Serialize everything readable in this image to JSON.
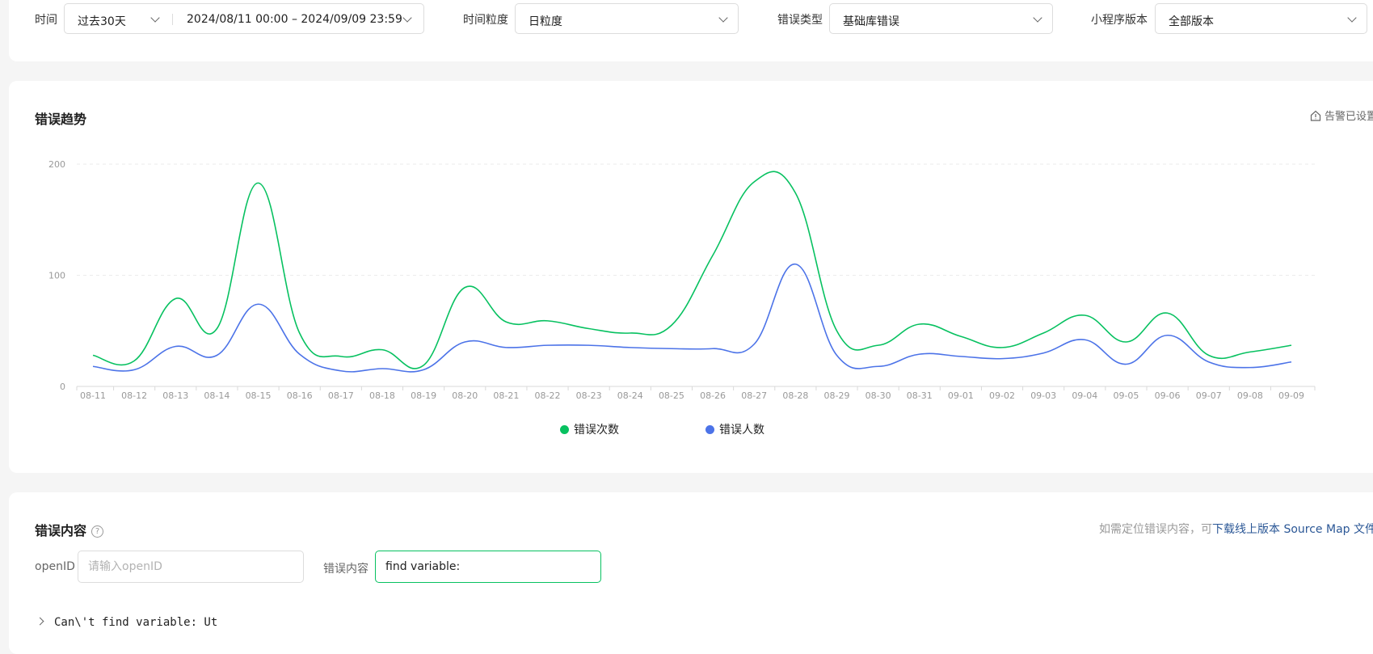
{
  "filters": {
    "time_label": "时间",
    "time_range_preset": "过去30天",
    "time_range_value": "2024/08/11 00:00 – 2024/09/09 23:59",
    "granularity_label": "时间粒度",
    "granularity_value": "日粒度",
    "error_type_label": "错误类型",
    "error_type_value": "基础库错误",
    "version_label": "小程序版本",
    "version_value": "全部版本"
  },
  "trend": {
    "title": "错误趋势",
    "alert_text": "告警已设置",
    "alert_icon": "house-icon"
  },
  "colors": {
    "green": "#07c160",
    "blue": "#4c73e8",
    "link": "#2b5796"
  },
  "chart_data": {
    "type": "line",
    "categories": [
      "08-11",
      "08-12",
      "08-13",
      "08-14",
      "08-15",
      "08-16",
      "08-17",
      "08-18",
      "08-19",
      "08-20",
      "08-21",
      "08-22",
      "08-23",
      "08-24",
      "08-25",
      "08-26",
      "08-27",
      "08-28",
      "08-29",
      "08-30",
      "08-31",
      "09-01",
      "09-02",
      "09-03",
      "09-04",
      "09-05",
      "09-06",
      "09-07",
      "09-08",
      "09-09"
    ],
    "series": [
      {
        "name": "错误次数",
        "color": "#07c160",
        "values": [
          28,
          23,
          79,
          52,
          183,
          48,
          27,
          33,
          19,
          89,
          58,
          59,
          52,
          48,
          55,
          118,
          184,
          174,
          50,
          37,
          56,
          45,
          35,
          48,
          64,
          40,
          66,
          28,
          31,
          37
        ]
      },
      {
        "name": "错误人数",
        "color": "#4c73e8",
        "values": [
          18,
          15,
          36,
          28,
          74,
          29,
          14,
          16,
          15,
          40,
          35,
          37,
          37,
          35,
          34,
          34,
          38,
          110,
          28,
          18,
          29,
          27,
          25,
          30,
          42,
          20,
          46,
          22,
          17,
          22
        ]
      }
    ],
    "yticks": [
      0,
      100,
      200
    ],
    "ylim": [
      0,
      200
    ],
    "grid": true,
    "legend": "bottom"
  },
  "content": {
    "title": "错误内容",
    "hint_prefix": "如需定位错误内容，可",
    "hint_link": "下载线上版本 Source Map 文件",
    "openid_label": "openID",
    "openid_placeholder": "请输入openID",
    "error_content_label": "错误内容",
    "error_content_value": "find variable:",
    "error_row": "Can\\'t find variable: Ut"
  }
}
